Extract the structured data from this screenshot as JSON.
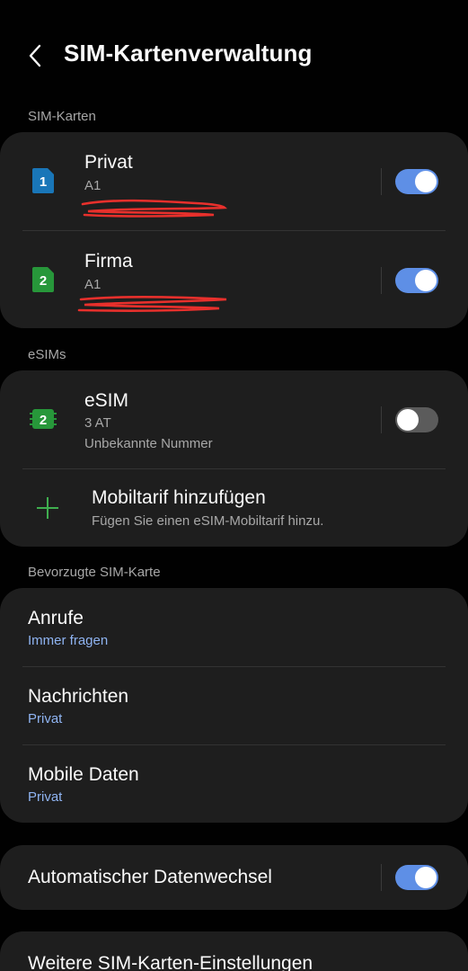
{
  "header": {
    "title": "SIM-Kartenverwaltung"
  },
  "sim_cards": {
    "section_label": "SIM-Karten",
    "items": [
      {
        "slot": "1",
        "name": "Privat",
        "carrier": "A1",
        "enabled": true
      },
      {
        "slot": "2",
        "name": "Firma",
        "carrier": "A1",
        "enabled": true
      }
    ]
  },
  "esims": {
    "section_label": "eSIMs",
    "item": {
      "slot": "2",
      "name": "eSIM",
      "carrier": "3 AT",
      "number": "Unbekannte Nummer",
      "enabled": false
    },
    "add_plan": {
      "title": "Mobiltarif hinzufügen",
      "subtitle": "Fügen Sie einen eSIM-Mobiltarif hinzu."
    }
  },
  "preferred": {
    "section_label": "Bevorzugte SIM-Karte",
    "items": [
      {
        "label": "Anrufe",
        "value": "Immer fragen"
      },
      {
        "label": "Nachrichten",
        "value": "Privat"
      },
      {
        "label": "Mobile Daten",
        "value": "Privat"
      }
    ]
  },
  "auto_switch": {
    "label": "Automatischer Datenwechsel",
    "enabled": true
  },
  "more_settings": {
    "label": "Weitere SIM-Karten-Einstellungen"
  },
  "colors": {
    "sim1": "#1976b8",
    "sim2": "#27973a",
    "toggle_on": "#5e8fe6",
    "link": "#8fb4f2",
    "plus": "#3fae4f"
  }
}
